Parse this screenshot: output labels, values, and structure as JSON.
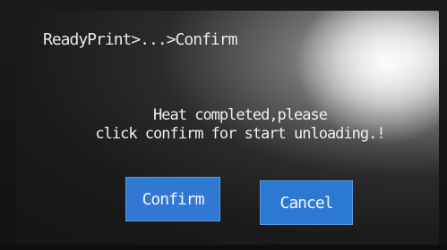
{
  "screen": {
    "breadcrumb": "ReadyPrint>...>Confirm",
    "message_line1": "Heat completed,please",
    "message_line2": "click confirm for start unloading.!",
    "buttons": {
      "confirm_label": "Confirm",
      "cancel_label": "Cancel"
    }
  },
  "colors": {
    "screen_background": "#1a1a1a",
    "button_blue": "#2f79d6",
    "text": "#f0f0f2"
  }
}
